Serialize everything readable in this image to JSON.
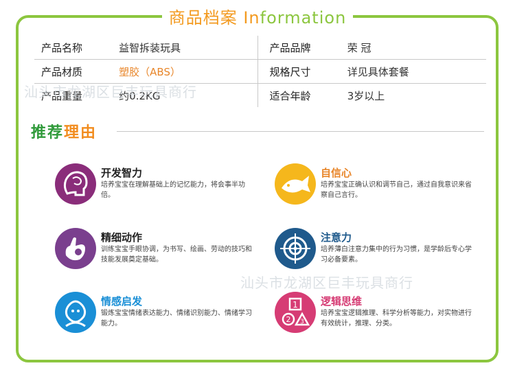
{
  "header": {
    "title_cn": "商品档案",
    "title_en_first": "In",
    "title_en_rest": "formation"
  },
  "spec": {
    "rows": [
      {
        "l1": "产品名称",
        "v1": "益智拆装玩具",
        "l2": "产品品牌",
        "v2": "荣 冠"
      },
      {
        "l1": "产品材质",
        "v1": "塑胶（ABS）",
        "l2": "规格尺寸",
        "v2": "详见具体套餐"
      },
      {
        "l1": "产品重量",
        "v1": "约0.2KG",
        "l2": "适合年龄",
        "v2": "3岁以上"
      }
    ]
  },
  "reasons": {
    "heading_1": "推荐",
    "heading_2": "理由",
    "items": [
      {
        "title": "开发智力",
        "desc": "培养宝宝在理解基础上的记忆能力，将会事半功倍。",
        "icon": "brain-icon",
        "color": "#8a2d7a"
      },
      {
        "title": "自信心",
        "desc": "培养宝宝正确认识和调节自己，通过自我意识来省察自己言行。",
        "icon": "fish-icon",
        "color": "#f5b71c"
      },
      {
        "title": "精细动作",
        "desc": "训练宝宝手眼协调，为书写、绘画、劳动的技巧和技能发展奠定基础。",
        "icon": "hand-icon",
        "color": "#7a3f8e"
      },
      {
        "title": "注意力",
        "desc": "培养薄白注意力集中的行为习惯，是学龄后专心学习必备要素。",
        "icon": "target-icon",
        "color": "#1f5a8c"
      },
      {
        "title": "情感启发",
        "desc": "锻炼宝宝情绪表达能力、情绪识别能力、情绪学习能力。",
        "icon": "child-face-icon",
        "color": "#1a8fd6"
      },
      {
        "title": "逻辑思维",
        "desc": "培养宝宝逻辑推理、科学分析等能力，对实物进行有效统计，推理、分类。",
        "icon": "numbers-icon",
        "color": "#d63c74"
      }
    ]
  },
  "watermarks": {
    "wm1": "汕头市龙湖区巨丰玩具商行",
    "wm2": "汕头市龙湖区巨丰玩具商行"
  }
}
